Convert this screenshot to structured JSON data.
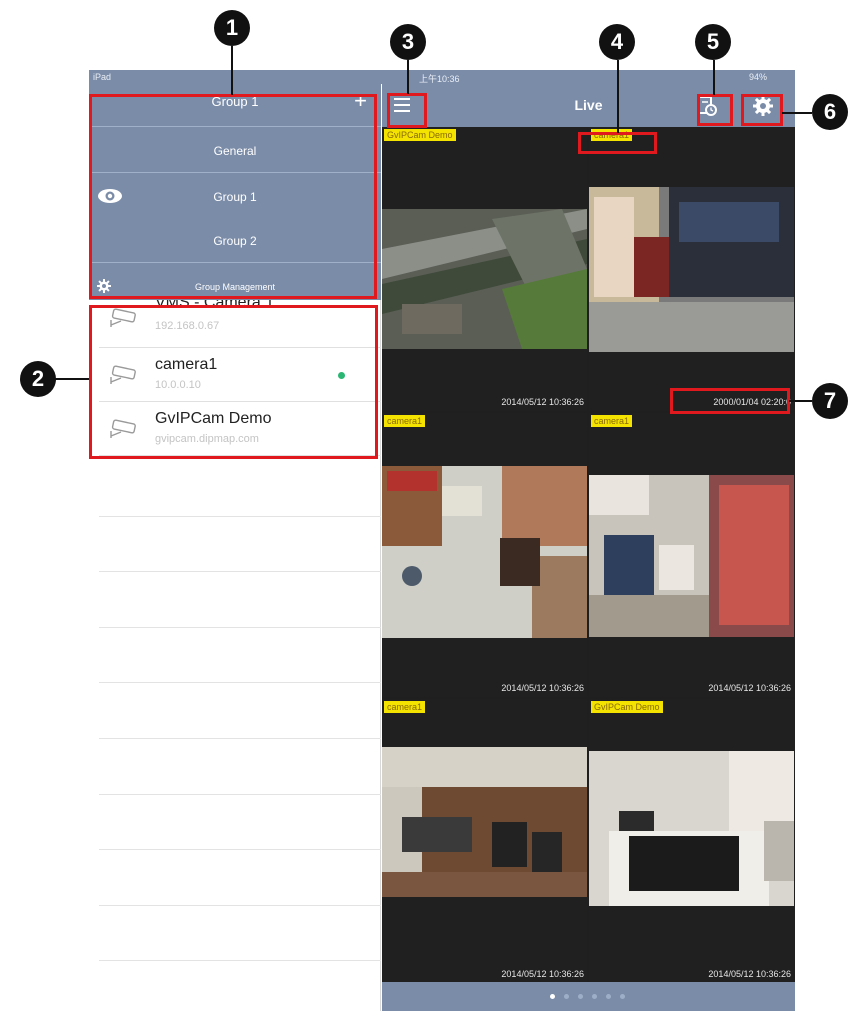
{
  "status_bar": {
    "device": "iPad",
    "time": "上午10:36",
    "battery": "94%"
  },
  "group_menu": {
    "title": "Group 1",
    "add_label": "+",
    "items": [
      "General",
      "Group 1",
      "Group 2"
    ],
    "selected_index": 1,
    "management_label": "Group Management"
  },
  "camera_list": [
    {
      "name": "VMS - Camera 1",
      "address": "192.168.0.67",
      "online": false
    },
    {
      "name": "camera1",
      "address": "10.0.0.10",
      "online": true
    },
    {
      "name": "GvIPCam Demo",
      "address": "gvipcam.dipmap.com",
      "online": false
    }
  ],
  "live": {
    "title": "Live",
    "cells": [
      {
        "label": "GvIPCam Demo",
        "timestamp": "2014/05/12 10:36:26",
        "scene": "aerial-street"
      },
      {
        "label": "camera1",
        "timestamp": "2000/01/04 02:20:0",
        "scene": "indoor-shelf"
      },
      {
        "label": "camera1",
        "timestamp": "2014/05/12 10:36:26",
        "scene": "store-overhead"
      },
      {
        "label": "camera1",
        "timestamp": "2014/05/12 10:36:26",
        "scene": "store-counter"
      },
      {
        "label": "camera1",
        "timestamp": "2014/05/12 10:36:26",
        "scene": "office-desks"
      },
      {
        "label": "GvIPCam Demo",
        "timestamp": "2014/05/12 10:36:26",
        "scene": "office-monitor"
      }
    ],
    "page_count": 6,
    "current_page": 1
  },
  "callouts": [
    "1",
    "2",
    "3",
    "4",
    "5",
    "6",
    "7"
  ],
  "colors": {
    "bar": "#7b8ca8",
    "highlight": "#e0191e",
    "label_bg": "#f4e300",
    "online": "#2bb673"
  }
}
